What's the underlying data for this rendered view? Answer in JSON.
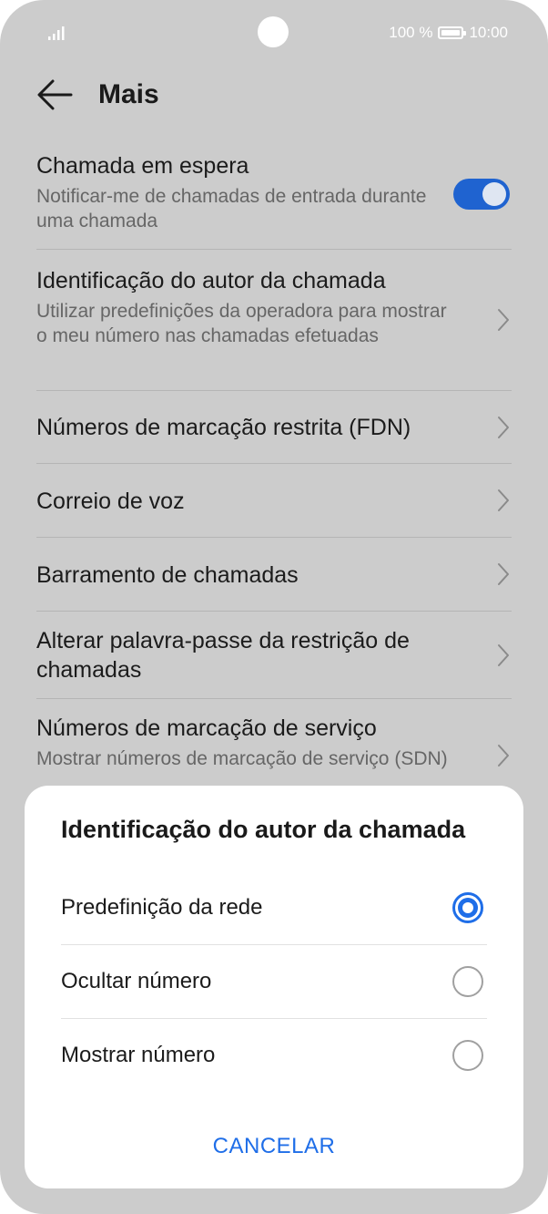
{
  "status_bar": {
    "battery_text": "100 %",
    "time": "10:00"
  },
  "header": {
    "title": "Mais"
  },
  "settings": [
    {
      "title": "Chamada em espera",
      "subtitle": "Notificar-me de chamadas de entrada durante uma chamada",
      "control": "toggle",
      "toggle_on": true
    },
    {
      "title": "Identificação do autor da chamada",
      "subtitle": "Utilizar predefinições da operadora para mostrar o meu número nas chamadas efetuadas",
      "control": "chevron"
    },
    {
      "title": "Números de marcação restrita (FDN)",
      "control": "chevron"
    },
    {
      "title": "Correio de voz",
      "control": "chevron"
    },
    {
      "title": "Barramento de chamadas",
      "control": "chevron"
    },
    {
      "title": "Alterar palavra-passe da restrição de chamadas",
      "control": "chevron"
    },
    {
      "title": "Números de marcação de serviço",
      "subtitle": "Mostrar números de marcação de serviço (SDN)",
      "control": "chevron"
    }
  ],
  "dialog": {
    "title": "Identificação do autor da chamada",
    "options": [
      {
        "label": "Predefinição da rede",
        "selected": true
      },
      {
        "label": "Ocultar número",
        "selected": false
      },
      {
        "label": "Mostrar número",
        "selected": false
      }
    ],
    "cancel_label": "CANCELAR"
  },
  "colors": {
    "accent": "#1f6ee8",
    "toggle_on": "#1f63d0",
    "scrim_background": "#cccccc"
  }
}
